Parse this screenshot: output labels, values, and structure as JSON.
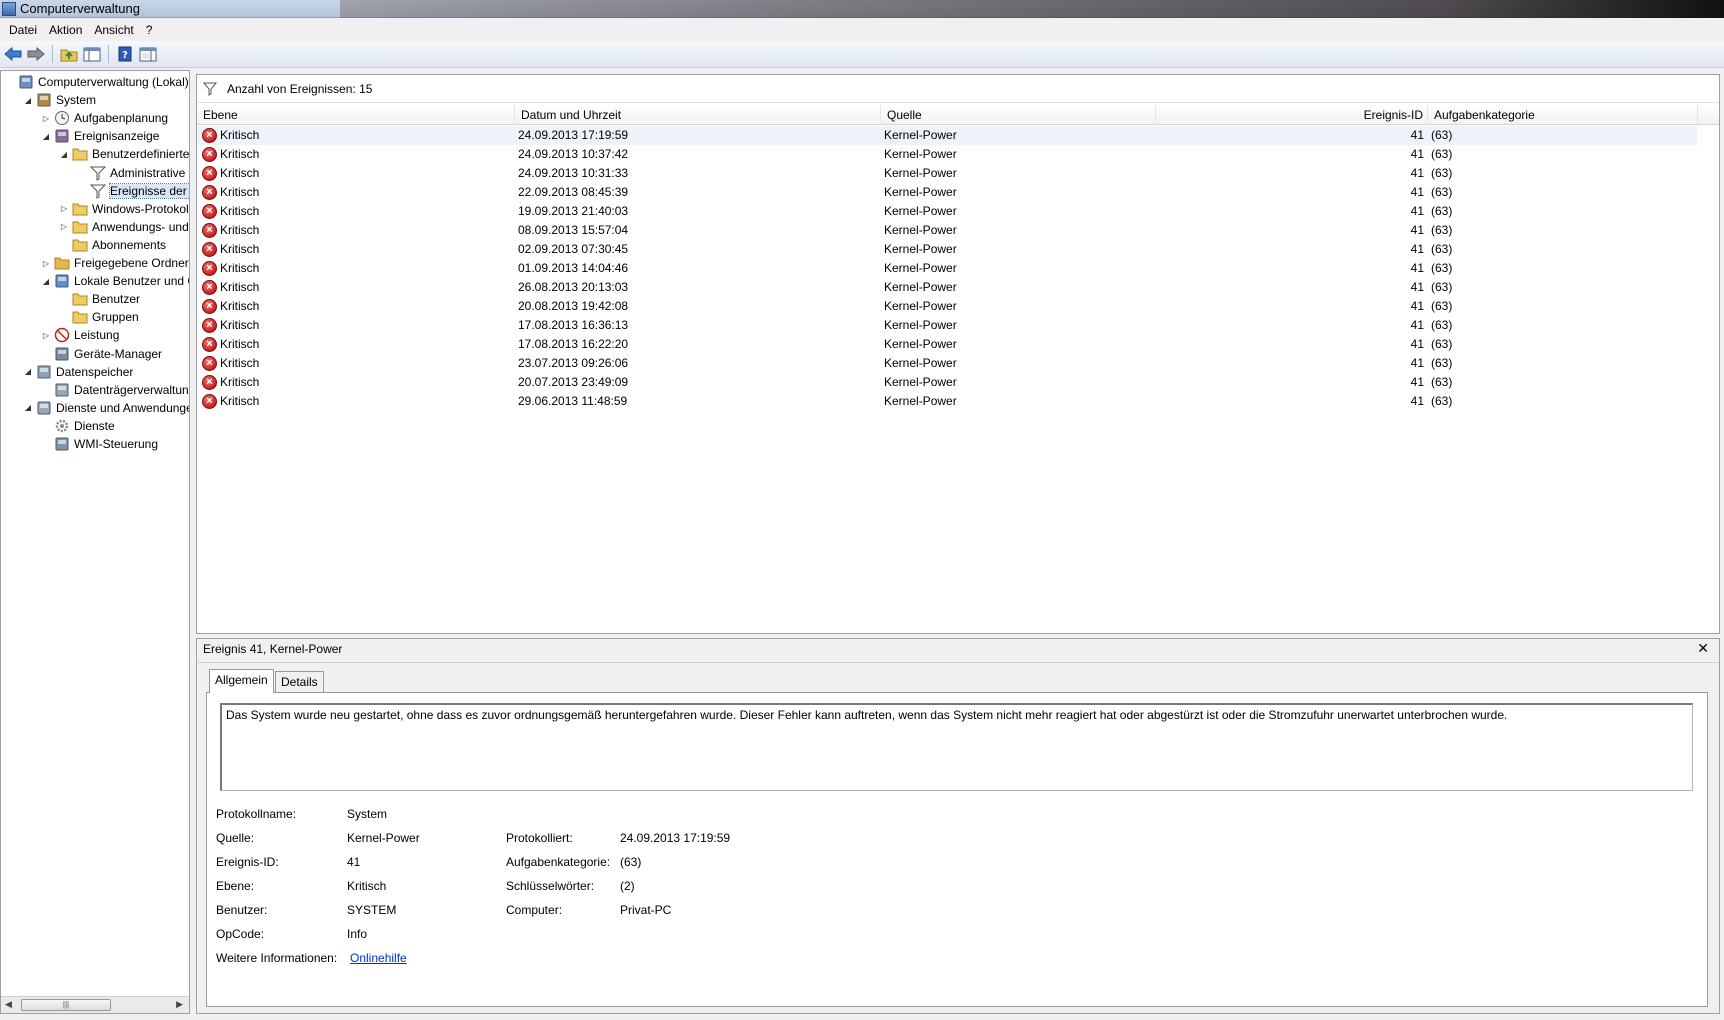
{
  "window": {
    "title": "Computerverwaltung"
  },
  "menu": [
    "Datei",
    "Aktion",
    "Ansicht",
    "?"
  ],
  "tree": [
    {
      "label": "Computerverwaltung (Lokal)",
      "level": 0,
      "expander": "",
      "icon": "computer-management-icon",
      "selected": false
    },
    {
      "label": "System",
      "level": 1,
      "expander": "open",
      "icon": "tools-icon",
      "selected": false
    },
    {
      "label": "Aufgabenplanung",
      "level": 2,
      "expander": "closed",
      "icon": "clock-icon",
      "selected": false
    },
    {
      "label": "Ereignisanzeige",
      "level": 2,
      "expander": "open",
      "icon": "event-viewer-icon",
      "selected": false
    },
    {
      "label": "Benutzerdefinierte A",
      "level": 3,
      "expander": "open",
      "icon": "folder-icon",
      "selected": false
    },
    {
      "label": "Administrative E",
      "level": 4,
      "expander": "",
      "icon": "filter-icon",
      "selected": false
    },
    {
      "label": "Ereignisse der Zu",
      "level": 4,
      "expander": "",
      "icon": "filter-icon",
      "selected": true
    },
    {
      "label": "Windows-Protokolle",
      "level": 3,
      "expander": "closed",
      "icon": "folder-icon",
      "selected": false
    },
    {
      "label": "Anwendungs- und D",
      "level": 3,
      "expander": "closed",
      "icon": "folder-icon",
      "selected": false
    },
    {
      "label": "Abonnements",
      "level": 3,
      "expander": "",
      "icon": "subscription-icon",
      "selected": false
    },
    {
      "label": "Freigegebene Ordner",
      "level": 2,
      "expander": "closed",
      "icon": "shared-folder-icon",
      "selected": false
    },
    {
      "label": "Lokale Benutzer und Gr",
      "level": 2,
      "expander": "open",
      "icon": "users-icon",
      "selected": false
    },
    {
      "label": "Benutzer",
      "level": 3,
      "expander": "",
      "icon": "folder-icon",
      "selected": false
    },
    {
      "label": "Gruppen",
      "level": 3,
      "expander": "",
      "icon": "folder-icon",
      "selected": false
    },
    {
      "label": "Leistung",
      "level": 2,
      "expander": "closed",
      "icon": "performance-icon",
      "selected": false
    },
    {
      "label": "Geräte-Manager",
      "level": 2,
      "expander": "",
      "icon": "device-manager-icon",
      "selected": false
    },
    {
      "label": "Datenspeicher",
      "level": 1,
      "expander": "open",
      "icon": "storage-icon",
      "selected": false
    },
    {
      "label": "Datenträgerverwaltung",
      "level": 2,
      "expander": "",
      "icon": "disk-icon",
      "selected": false
    },
    {
      "label": "Dienste und Anwendungen",
      "level": 1,
      "expander": "open",
      "icon": "services-apps-icon",
      "selected": false
    },
    {
      "label": "Dienste",
      "level": 2,
      "expander": "",
      "icon": "gear-icon",
      "selected": false
    },
    {
      "label": "WMI-Steuerung",
      "level": 2,
      "expander": "",
      "icon": "wmi-icon",
      "selected": false
    }
  ],
  "list": {
    "count_label": "Anzahl von Ereignissen: 15",
    "columns": [
      "Ebene",
      "Datum und Uhrzeit",
      "Quelle",
      "Ereignis-ID",
      "Aufgabenkategorie"
    ],
    "rows": [
      {
        "level": "Kritisch",
        "datetime": "24.09.2013 17:19:59",
        "source": "Kernel-Power",
        "id": "41",
        "category": "(63)"
      },
      {
        "level": "Kritisch",
        "datetime": "24.09.2013 10:37:42",
        "source": "Kernel-Power",
        "id": "41",
        "category": "(63)"
      },
      {
        "level": "Kritisch",
        "datetime": "24.09.2013 10:31:33",
        "source": "Kernel-Power",
        "id": "41",
        "category": "(63)"
      },
      {
        "level": "Kritisch",
        "datetime": "22.09.2013 08:45:39",
        "source": "Kernel-Power",
        "id": "41",
        "category": "(63)"
      },
      {
        "level": "Kritisch",
        "datetime": "19.09.2013 21:40:03",
        "source": "Kernel-Power",
        "id": "41",
        "category": "(63)"
      },
      {
        "level": "Kritisch",
        "datetime": "08.09.2013 15:57:04",
        "source": "Kernel-Power",
        "id": "41",
        "category": "(63)"
      },
      {
        "level": "Kritisch",
        "datetime": "02.09.2013 07:30:45",
        "source": "Kernel-Power",
        "id": "41",
        "category": "(63)"
      },
      {
        "level": "Kritisch",
        "datetime": "01.09.2013 14:04:46",
        "source": "Kernel-Power",
        "id": "41",
        "category": "(63)"
      },
      {
        "level": "Kritisch",
        "datetime": "26.08.2013 20:13:03",
        "source": "Kernel-Power",
        "id": "41",
        "category": "(63)"
      },
      {
        "level": "Kritisch",
        "datetime": "20.08.2013 19:42:08",
        "source": "Kernel-Power",
        "id": "41",
        "category": "(63)"
      },
      {
        "level": "Kritisch",
        "datetime": "17.08.2013 16:36:13",
        "source": "Kernel-Power",
        "id": "41",
        "category": "(63)"
      },
      {
        "level": "Kritisch",
        "datetime": "17.08.2013 16:22:20",
        "source": "Kernel-Power",
        "id": "41",
        "category": "(63)"
      },
      {
        "level": "Kritisch",
        "datetime": "23.07.2013 09:26:06",
        "source": "Kernel-Power",
        "id": "41",
        "category": "(63)"
      },
      {
        "level": "Kritisch",
        "datetime": "20.07.2013 23:49:09",
        "source": "Kernel-Power",
        "id": "41",
        "category": "(63)"
      },
      {
        "level": "Kritisch",
        "datetime": "29.06.2013 11:48:59",
        "source": "Kernel-Power",
        "id": "41",
        "category": "(63)"
      }
    ]
  },
  "detail": {
    "title": "Ereignis 41, Kernel-Power",
    "tabs": [
      "Allgemein",
      "Details"
    ],
    "description": "Das System wurde neu gestartet, ohne dass es zuvor ordnungsgemäß heruntergefahren wurde. Dieser Fehler kann auftreten, wenn das System nicht mehr reagiert hat oder abgestürzt ist oder die Stromzufuhr unerwartet unterbrochen wurde.",
    "labels": {
      "log_name": "Protokollname:",
      "source": "Quelle:",
      "event_id": "Ereignis-ID:",
      "level": "Ebene:",
      "user": "Benutzer:",
      "opcode": "OpCode:",
      "more_info": "Weitere Informationen:",
      "logged": "Protokolliert:",
      "task_category": "Aufgabenkategorie:",
      "keywords": "Schlüsselwörter:",
      "computer": "Computer:"
    },
    "values": {
      "log_name": "System",
      "source": "Kernel-Power",
      "event_id": "41",
      "level": "Kritisch",
      "user": "SYSTEM",
      "opcode": "Info",
      "more_info": "Onlinehilfe",
      "logged": "24.09.2013 17:19:59",
      "task_category": "(63)",
      "keywords": "(2)",
      "computer": "Privat-PC"
    }
  }
}
